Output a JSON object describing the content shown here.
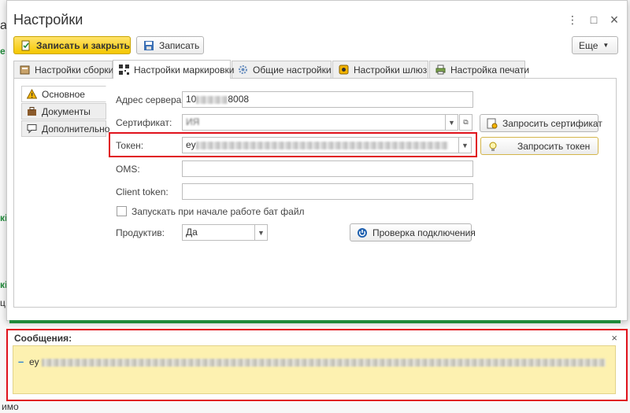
{
  "background": {
    "fragments": [
      "а",
      "е",
      "кі",
      "кі",
      "ц",
      "имо"
    ]
  },
  "dialog": {
    "title": "Настройки",
    "controls": {
      "more": "⋮",
      "maximize": "□",
      "close": "×"
    }
  },
  "toolbar": {
    "save_close_label": "Записать и закрыть",
    "save_label": "Записать",
    "more_label": "Еще"
  },
  "tabs": [
    {
      "label": "Настройки сборки",
      "icon": "settings-doc-icon"
    },
    {
      "label": "Настройки маркировки",
      "icon": "qr-code-icon",
      "active": true
    },
    {
      "label": "Общие настройки",
      "icon": "gear-icon"
    },
    {
      "label": "Настройки шлюз",
      "icon": "gateway-icon"
    },
    {
      "label": "Настройка печати",
      "icon": "printer-icon"
    }
  ],
  "subnav": [
    {
      "label": "Основное",
      "icon": "warning-icon",
      "active": true
    },
    {
      "label": "Документы",
      "icon": "briefcase-icon"
    },
    {
      "label": "Дополнительно",
      "icon": "comment-icon"
    }
  ],
  "form": {
    "server_label": "Адрес сервера:",
    "server_prefix": "10",
    "server_suffix": "8008",
    "cert_label": "Сертификат:",
    "cert_value": "ИЯ",
    "cert_button": "Запросить сертификат",
    "token_label": "Токен:",
    "token_value": "ey",
    "token_button": "Запросить токен",
    "oms_label": "OMS:",
    "client_token_label": "Client token:",
    "run_bat_label": "Запускать при начале работе бат файл",
    "production_label": "Продуктив:",
    "production_value": "Да",
    "check_connection_label": "Проверка подключения"
  },
  "messages": {
    "title": "Сообщения:",
    "close": "×",
    "text": "ey"
  },
  "colors": {
    "accent_yellow": "#f4c700",
    "highlight_red": "#e0121c",
    "separator_green": "#1f8a3a",
    "message_bg": "#fdf1b0"
  }
}
